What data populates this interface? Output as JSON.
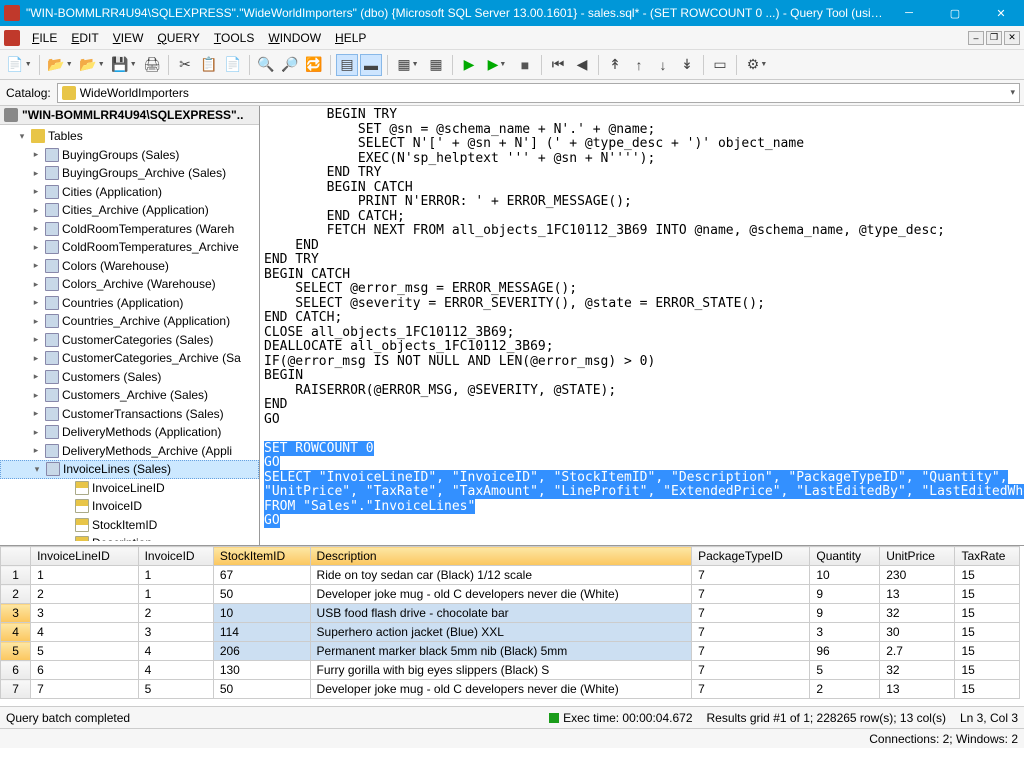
{
  "title": "\"WIN-BOMMLRR4U94\\SQLEXPRESS\".\"WideWorldImporters\" (dbo) {Microsoft SQL Server 13.00.1601} - sales.sql* - (SET ROWCOUNT 0 ...) - Query Tool (using AD...",
  "menu": {
    "file": "FILE",
    "edit": "EDIT",
    "view": "VIEW",
    "query": "QUERY",
    "tools": "TOOLS",
    "window": "WINDOW",
    "help": "HELP"
  },
  "catalog": {
    "label": "Catalog:",
    "selected": "WideWorldImporters"
  },
  "tree": {
    "server": "\"WIN-BOMMLRR4U94\\SQLEXPRESS\"..",
    "tables_label": "Tables",
    "items": [
      "BuyingGroups (Sales)",
      "BuyingGroups_Archive (Sales)",
      "Cities (Application)",
      "Cities_Archive (Application)",
      "ColdRoomTemperatures (Wareh",
      "ColdRoomTemperatures_Archive",
      "Colors (Warehouse)",
      "Colors_Archive (Warehouse)",
      "Countries (Application)",
      "Countries_Archive (Application)",
      "CustomerCategories (Sales)",
      "CustomerCategories_Archive (Sa",
      "Customers (Sales)",
      "Customers_Archive (Sales)",
      "CustomerTransactions (Sales)",
      "DeliveryMethods (Application)",
      "DeliveryMethods_Archive (Appli"
    ],
    "selected": "InvoiceLines (Sales)",
    "columns": [
      "InvoiceLineID",
      "InvoiceID",
      "StockItemID",
      "Description"
    ]
  },
  "sql": {
    "lines": [
      "        BEGIN TRY",
      "            SET @sn = @schema_name + N'.' + @name;",
      "            SELECT N'[' + @sn + N'] (' + @type_desc + ')' object_name",
      "            EXEC(N'sp_helptext ''' + @sn + N'''');",
      "        END TRY",
      "        BEGIN CATCH",
      "            PRINT N'ERROR: ' + ERROR_MESSAGE();",
      "        END CATCH;",
      "        FETCH NEXT FROM all_objects_1FC10112_3B69 INTO @name, @schema_name, @type_desc;",
      "    END",
      "END TRY",
      "BEGIN CATCH",
      "    SELECT @error_msg = ERROR_MESSAGE();",
      "    SELECT @severity = ERROR_SEVERITY(), @state = ERROR_STATE();",
      "END CATCH;",
      "CLOSE all_objects_1FC10112_3B69;",
      "DEALLOCATE all_objects_1FC10112_3B69;",
      "IF(@error_msg IS NOT NULL AND LEN(@error_msg) > 0)",
      "BEGIN",
      "    RAISERROR(@ERROR_MSG, @SEVERITY, @STATE);",
      "END",
      "GO",
      ""
    ],
    "selected_lines": [
      "SET ROWCOUNT 0",
      "GO",
      "SELECT \"InvoiceLineID\", \"InvoiceID\", \"StockItemID\", \"Description\", \"PackageTypeID\", \"Quantity\",",
      "\"UnitPrice\", \"TaxRate\", \"TaxAmount\", \"LineProfit\", \"ExtendedPrice\", \"LastEditedBy\", \"LastEditedWhen\"",
      "FROM \"Sales\".\"InvoiceLines\"",
      "GO"
    ]
  },
  "grid": {
    "headers": [
      "InvoiceLineID",
      "InvoiceID",
      "StockItemID",
      "Description",
      "PackageTypeID",
      "Quantity",
      "UnitPrice",
      "TaxRate"
    ],
    "rows": [
      [
        "1",
        "1",
        "67",
        "Ride on toy sedan car (Black) 1/12 scale",
        "7",
        "10",
        "230",
        "15"
      ],
      [
        "2",
        "1",
        "50",
        "Developer joke mug - old C developers never die (White)",
        "7",
        "9",
        "13",
        "15"
      ],
      [
        "3",
        "2",
        "10",
        "USB food flash drive - chocolate bar",
        "7",
        "9",
        "32",
        "15"
      ],
      [
        "4",
        "3",
        "114",
        "Superhero action jacket (Blue) XXL",
        "7",
        "3",
        "30",
        "15"
      ],
      [
        "5",
        "4",
        "206",
        "Permanent marker black 5mm nib (Black) 5mm",
        "7",
        "96",
        "2.7",
        "15"
      ],
      [
        "6",
        "4",
        "130",
        "Furry gorilla with big eyes slippers (Black) S",
        "7",
        "5",
        "32",
        "15"
      ],
      [
        "7",
        "5",
        "50",
        "Developer joke mug - old C developers never die (White)",
        "7",
        "2",
        "13",
        "15"
      ]
    ],
    "sel_cols": [
      2,
      3
    ],
    "sel_rows": [
      2,
      3,
      4
    ]
  },
  "status": {
    "left": "Query batch completed",
    "exec": "Exec time: 00:00:04.672",
    "results": "Results grid #1 of 1; 228265 row(s); 13 col(s)",
    "pos": "Ln 3, Col 3",
    "conn": "Connections: 2; Windows: 2"
  }
}
